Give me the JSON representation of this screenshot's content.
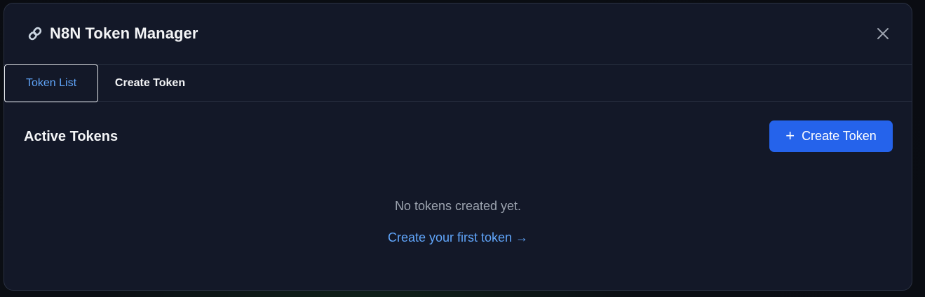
{
  "modal": {
    "title_icon": "link-icon",
    "title": "N8N Token Manager",
    "close_icon": "close-icon"
  },
  "tabs": [
    {
      "label": "Token List",
      "active": true
    },
    {
      "label": "Create Token",
      "active": false
    }
  ],
  "section": {
    "title": "Active Tokens",
    "create_button": {
      "icon": "plus-icon",
      "plus": "+",
      "label": "Create Token"
    }
  },
  "empty_state": {
    "message": "No tokens created yet.",
    "link_text": "Create your first token →"
  },
  "colors": {
    "modal_bg": "#131828",
    "border": "#2a3142",
    "accent": "#2563eb",
    "link": "#60a5fa",
    "muted_text": "#9ca3af",
    "text": "#f3f4f6"
  }
}
